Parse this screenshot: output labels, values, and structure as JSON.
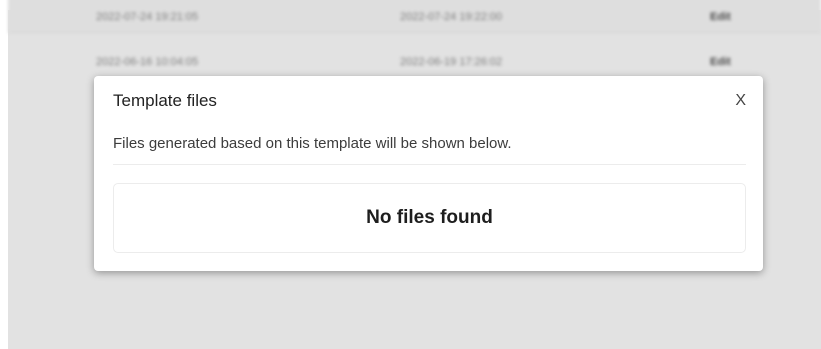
{
  "background_table": {
    "rows": [
      {
        "created": "2022-07-24 19:21:05",
        "modified": "2022-07-24 19:22:00",
        "action": "Edit"
      },
      {
        "created": "2022-06-16 10:04:05",
        "modified": "2022-06-19 17:26:02",
        "action": "Edit"
      }
    ]
  },
  "modal": {
    "title": "Template files",
    "close_label": "X",
    "description": "Files generated based on this template will be shown below.",
    "empty_message": "No files found"
  }
}
